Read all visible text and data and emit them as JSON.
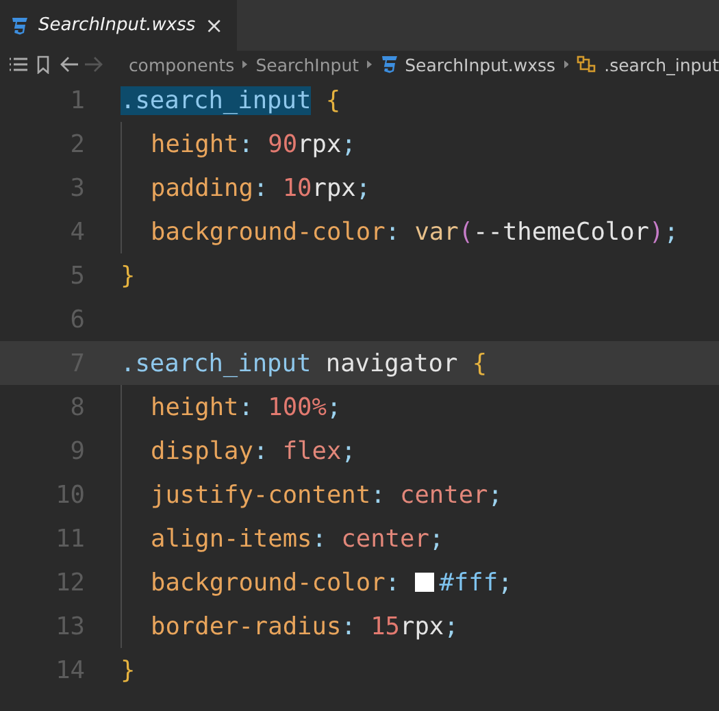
{
  "tabs": [
    {
      "label": "SearchInput.wxss",
      "selected": true,
      "close": "×"
    }
  ],
  "toolbar": [
    {
      "kind": "outline",
      "disabled": false
    },
    {
      "kind": "bookmark",
      "disabled": false
    },
    {
      "kind": "back",
      "disabled": false
    },
    {
      "kind": "forward",
      "disabled": true
    }
  ],
  "breadcrumbs": [
    {
      "label": "components",
      "kind": "folder"
    },
    {
      "label": "SearchInput",
      "kind": "folder"
    },
    {
      "label": "SearchInput.wxss",
      "kind": "file"
    },
    {
      "label": ".search_input",
      "kind": "symbol"
    }
  ],
  "lines": [
    {
      "number": "1",
      "current": false,
      "indent": false,
      "tokens": [
        {
          "text": ".search_input",
          "kind": "selector",
          "selected": true
        },
        {
          "text": "{",
          "kind": "brace",
          "selected": false
        }
      ]
    },
    {
      "number": "2",
      "current": false,
      "indent": true,
      "tokens": [
        {
          "text": "height",
          "kind": "property",
          "selected": false
        },
        {
          "text": ":",
          "kind": "punct",
          "selected": false
        },
        {
          "text": "90",
          "kind": "number",
          "selected": false
        },
        {
          "text": "rpx",
          "kind": "plain",
          "selected": false
        },
        {
          "text": ";",
          "kind": "punct",
          "selected": false
        }
      ]
    },
    {
      "number": "3",
      "current": false,
      "indent": true,
      "tokens": [
        {
          "text": "padding",
          "kind": "property",
          "selected": false
        },
        {
          "text": ":",
          "kind": "punct",
          "selected": false
        },
        {
          "text": "10",
          "kind": "number",
          "selected": false
        },
        {
          "text": "rpx",
          "kind": "plain",
          "selected": false
        },
        {
          "text": ";",
          "kind": "punct",
          "selected": false
        }
      ]
    },
    {
      "number": "4",
      "current": false,
      "indent": true,
      "tokens": [
        {
          "text": "background-color",
          "kind": "property",
          "selected": false
        },
        {
          "text": ":",
          "kind": "punct",
          "selected": false
        },
        {
          "text": "var",
          "kind": "function",
          "selected": false
        },
        {
          "text": "(",
          "kind": "paren",
          "selected": false
        },
        {
          "text": "--themeColor",
          "kind": "plain",
          "selected": false
        },
        {
          "text": ")",
          "kind": "paren",
          "selected": false
        },
        {
          "text": ";",
          "kind": "punct",
          "selected": false
        }
      ]
    },
    {
      "number": "5",
      "current": false,
      "indent": false,
      "tokens": [
        {
          "text": "}",
          "kind": "brace",
          "selected": false
        }
      ]
    },
    {
      "number": "6",
      "current": false,
      "indent": false
    },
    {
      "number": "7",
      "current": true,
      "indent": false,
      "tokens": [
        {
          "text": ".search_input",
          "kind": "selector",
          "selected": false
        },
        {
          "text": "navigator",
          "kind": "plain",
          "selected": false
        },
        {
          "text": "{",
          "kind": "brace",
          "selected": false
        }
      ]
    },
    {
      "number": "8",
      "current": false,
      "indent": true,
      "tokens": [
        {
          "text": "height",
          "kind": "property",
          "selected": false
        },
        {
          "text": ":",
          "kind": "punct",
          "selected": false
        },
        {
          "text": "100%",
          "kind": "number",
          "selected": false
        },
        {
          "text": ";",
          "kind": "punct",
          "selected": false
        }
      ]
    },
    {
      "number": "9",
      "current": false,
      "indent": true,
      "tokens": [
        {
          "text": "display",
          "kind": "property",
          "selected": false
        },
        {
          "text": ":",
          "kind": "punct",
          "selected": false
        },
        {
          "text": "flex",
          "kind": "keyword",
          "selected": false
        },
        {
          "text": ";",
          "kind": "punct",
          "selected": false
        }
      ]
    },
    {
      "number": "10",
      "current": false,
      "indent": true,
      "tokens": [
        {
          "text": "justify-content",
          "kind": "property",
          "selected": false
        },
        {
          "text": ":",
          "kind": "punct",
          "selected": false
        },
        {
          "text": "center",
          "kind": "keyword",
          "selected": false
        },
        {
          "text": ";",
          "kind": "punct",
          "selected": false
        }
      ]
    },
    {
      "number": "11",
      "current": false,
      "indent": true,
      "tokens": [
        {
          "text": "align-items",
          "kind": "property",
          "selected": false
        },
        {
          "text": ":",
          "kind": "punct",
          "selected": false
        },
        {
          "text": "center",
          "kind": "keyword",
          "selected": false
        },
        {
          "text": ";",
          "kind": "punct",
          "selected": false
        }
      ]
    },
    {
      "number": "12",
      "current": false,
      "indent": true,
      "tokens": [
        {
          "text": "background-color",
          "kind": "property",
          "selected": false
        },
        {
          "text": ":",
          "kind": "punct",
          "selected": false
        },
        {
          "kind": "swatch",
          "color": "#ffffff"
        },
        {
          "text": "#fff",
          "kind": "hex",
          "selected": false
        },
        {
          "text": ";",
          "kind": "punct",
          "selected": false
        }
      ]
    },
    {
      "number": "13",
      "current": false,
      "indent": true,
      "tokens": [
        {
          "text": "border-radius",
          "kind": "property",
          "selected": false
        },
        {
          "text": ":",
          "kind": "punct",
          "selected": false
        },
        {
          "text": "15",
          "kind": "number",
          "selected": false
        },
        {
          "text": "rpx",
          "kind": "plain",
          "selected": false
        },
        {
          "text": ";",
          "kind": "punct",
          "selected": false
        }
      ]
    },
    {
      "number": "14",
      "current": false,
      "indent": false,
      "tokens": [
        {
          "text": "}",
          "kind": "brace",
          "selected": false
        }
      ]
    }
  ]
}
